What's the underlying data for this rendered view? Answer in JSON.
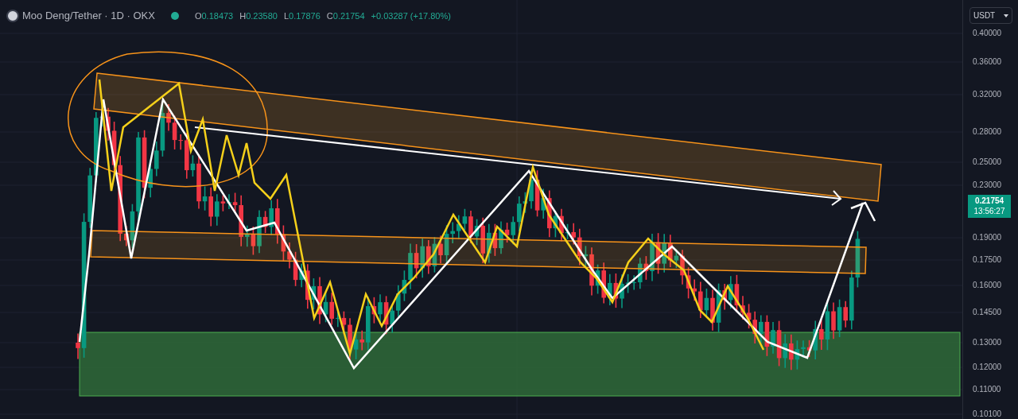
{
  "header": {
    "title": "Moo Deng/Tether · 1D · OKX",
    "ohlc": [
      {
        "label": "O",
        "value": "0.18473"
      },
      {
        "label": "H",
        "value": "0.23580"
      },
      {
        "label": "L",
        "value": "0.17876"
      },
      {
        "label": "C",
        "value": "0.21754"
      }
    ],
    "change": "+0.03287 (+17.80%)"
  },
  "currency_select": {
    "value": "USDT"
  },
  "price_axis": {
    "ticks": [
      "0.40000",
      "0.36000",
      "0.32000",
      "0.28000",
      "0.25000",
      "0.23000",
      "0.19000",
      "0.17500",
      "0.16000",
      "0.14500",
      "0.13000",
      "0.12000",
      "0.11000",
      "0.10100"
    ]
  },
  "last_price": {
    "price": "0.21754",
    "countdown": "13:56:27"
  }
}
